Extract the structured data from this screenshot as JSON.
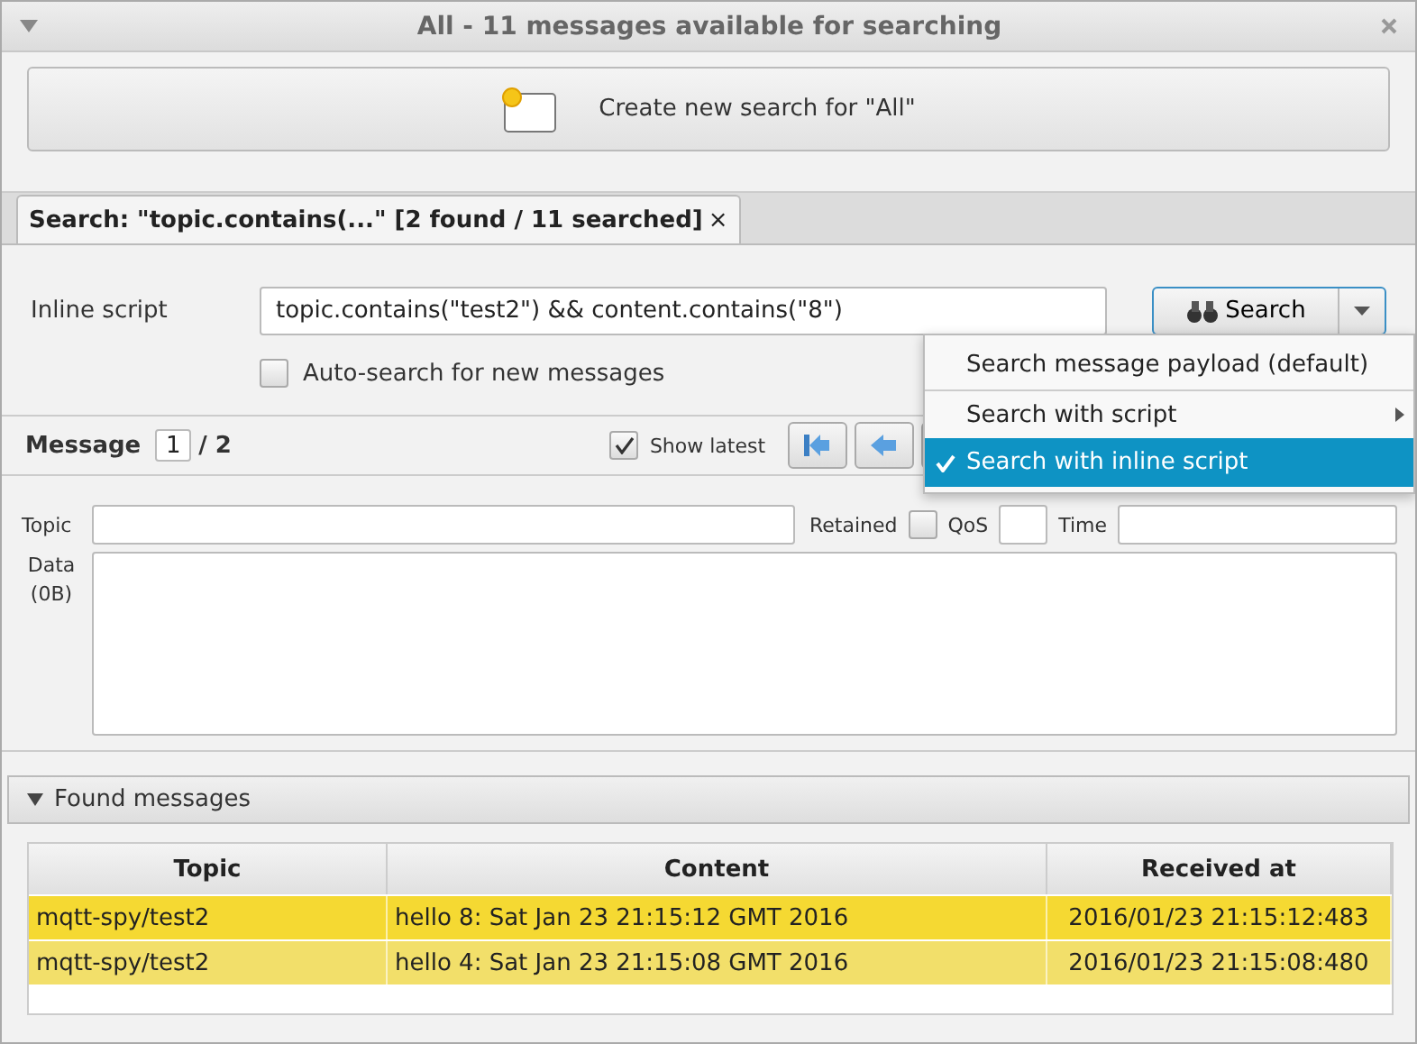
{
  "window": {
    "title": "All - 11 messages available for searching"
  },
  "create_button": {
    "label": "Create new search for \"All\""
  },
  "tabs": [
    {
      "label": "Search: \"topic.contains(...\" [2 found / 11 searched]",
      "close": "×",
      "selected": true
    }
  ],
  "inline_script": {
    "label": "Inline script",
    "value": "topic.contains(\"test2\") && content.contains(\"8\")"
  },
  "search_button": {
    "label": "Search"
  },
  "auto_search": {
    "label": "Auto-search for new messages",
    "checked": false
  },
  "search_menu": [
    {
      "label": "Search message payload (default)",
      "selected": false,
      "submenu": false
    },
    {
      "label": "Search with script",
      "selected": false,
      "submenu": true
    },
    {
      "label": "Search with inline script",
      "selected": true,
      "submenu": false
    }
  ],
  "message_bar": {
    "label": "Message",
    "index": "1",
    "total": "/ 2",
    "show_latest": {
      "label": "Show latest",
      "checked": true
    }
  },
  "details": {
    "topic_label": "Topic",
    "retained_label": "Retained",
    "retained": false,
    "qos_label": "QoS",
    "time_label": "Time",
    "data_label": "Data (0B)"
  },
  "found": {
    "title": "Found messages",
    "expanded": true,
    "columns": [
      "Topic",
      "Content",
      "Received at"
    ],
    "rows": [
      {
        "topic": "mqtt-spy/test2",
        "content": "hello 8: Sat Jan 23 21:15:12 GMT 2016",
        "received": "2016/01/23 21:15:12:483",
        "color": "#f5d932"
      },
      {
        "topic": "mqtt-spy/test2",
        "content": "hello 4: Sat Jan 23 21:15:08 GMT 2016",
        "received": "2016/01/23 21:15:08:480",
        "color": "#f2df6a"
      }
    ]
  }
}
